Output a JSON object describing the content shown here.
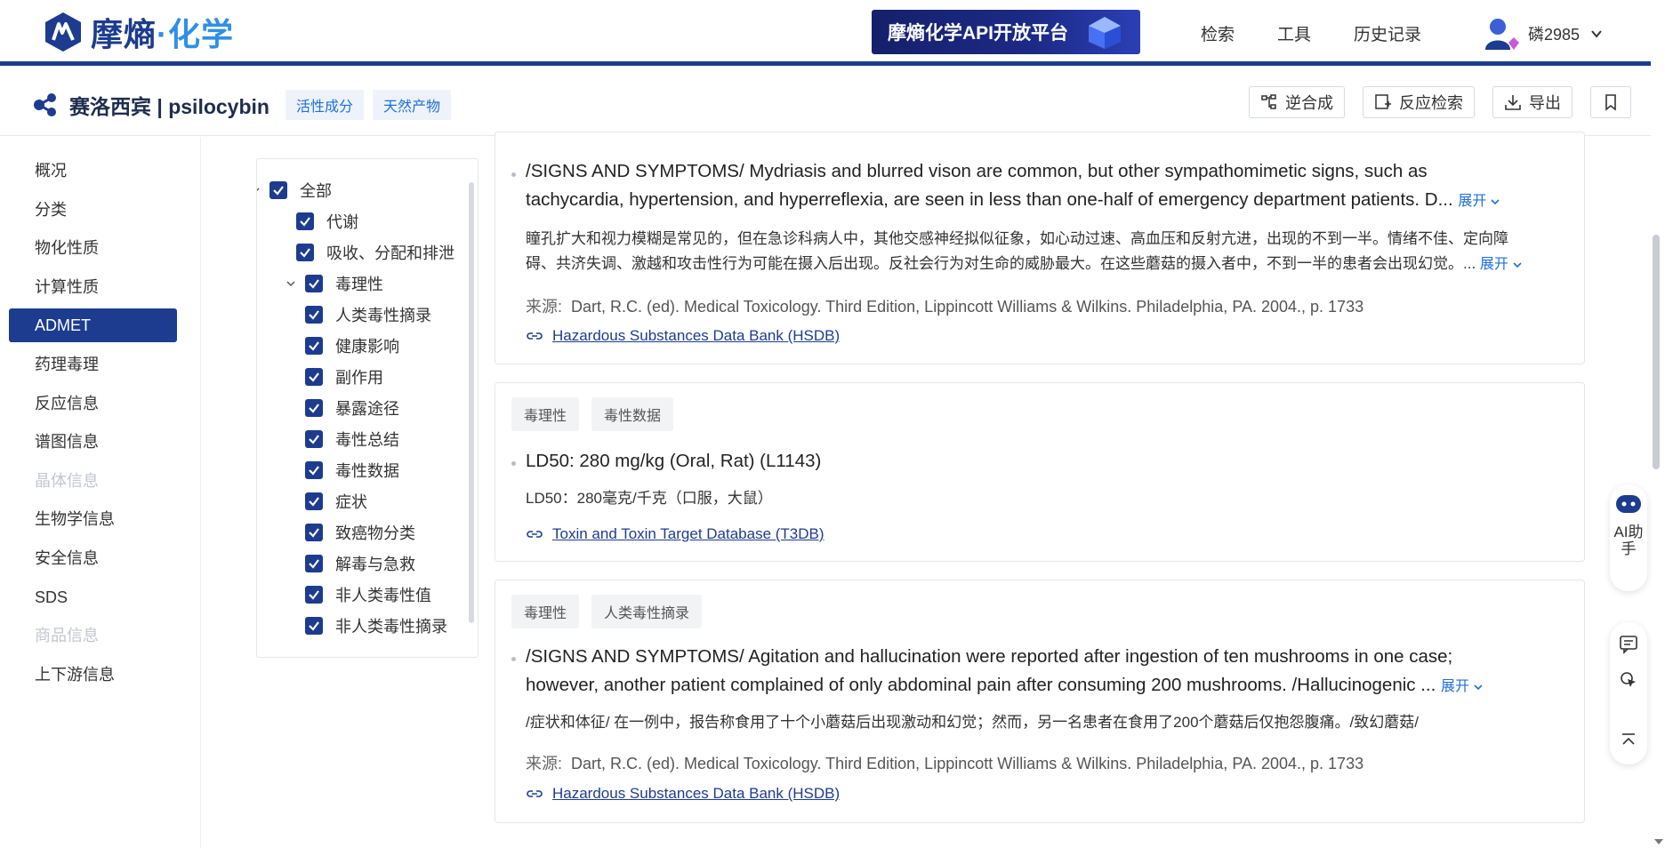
{
  "header": {
    "logo_main": "摩熵",
    "logo_dot": "·",
    "logo_accent": "化学",
    "api_banner": "摩熵化学API开放平台",
    "nav": [
      "检索",
      "工具",
      "历史记录"
    ],
    "username": "磷2985"
  },
  "compound": {
    "title": "赛洛西宾 | psilocybin",
    "tags": [
      "活性成分",
      "天然产物"
    ]
  },
  "toolbar": {
    "retro_label": "逆合成",
    "reaction_label": "反应检索",
    "export_label": "导出"
  },
  "sidebar": {
    "items": [
      {
        "label": "概况",
        "state": "normal"
      },
      {
        "label": "分类",
        "state": "normal"
      },
      {
        "label": "物化性质",
        "state": "normal"
      },
      {
        "label": "计算性质",
        "state": "normal"
      },
      {
        "label": "ADMET",
        "state": "active"
      },
      {
        "label": "药理毒理",
        "state": "normal"
      },
      {
        "label": "反应信息",
        "state": "normal"
      },
      {
        "label": "谱图信息",
        "state": "normal"
      },
      {
        "label": "晶体信息",
        "state": "disabled"
      },
      {
        "label": "生物学信息",
        "state": "normal"
      },
      {
        "label": "安全信息",
        "state": "normal"
      },
      {
        "label": "SDS",
        "state": "normal"
      },
      {
        "label": "商品信息",
        "state": "disabled"
      },
      {
        "label": "上下游信息",
        "state": "normal"
      }
    ]
  },
  "filter_tree": {
    "items": [
      {
        "label": "全部",
        "level": 0,
        "expandable": true
      },
      {
        "label": "代谢",
        "level": 1,
        "expandable": false
      },
      {
        "label": "吸收、分配和排泄",
        "level": 1,
        "expandable": false
      },
      {
        "label": "毒理性",
        "level": 1,
        "expandable": true
      },
      {
        "label": "人类毒性摘录",
        "level": 2,
        "expandable": false
      },
      {
        "label": "健康影响",
        "level": 2,
        "expandable": false
      },
      {
        "label": "副作用",
        "level": 2,
        "expandable": false
      },
      {
        "label": "暴露途径",
        "level": 2,
        "expandable": false
      },
      {
        "label": "毒性总结",
        "level": 2,
        "expandable": false
      },
      {
        "label": "毒性数据",
        "level": 2,
        "expandable": false
      },
      {
        "label": "症状",
        "level": 2,
        "expandable": false
      },
      {
        "label": "致癌物分类",
        "level": 2,
        "expandable": false
      },
      {
        "label": "解毒与急救",
        "level": 2,
        "expandable": false
      },
      {
        "label": "非人类毒性值",
        "level": 2,
        "expandable": false
      },
      {
        "label": "非人类毒性摘录",
        "level": 2,
        "expandable": false
      }
    ]
  },
  "cards": [
    {
      "en_line1": "/SIGNS AND SYMPTOMS/ Mydriasis and blurred vison are common, but other sympathomimetic signs, such as",
      "en_line2": "tachycardia, hypertension, and hyperreflexia, are seen in less than one-half of emergency department patients. D...",
      "cn_line1": "瞳孔扩大和视力模糊是常见的，但在急诊科病人中，其他交感神经拟似征象，如心动过速、高血压和反射亢进，出现的不到一半。情绪不佳、定向障",
      "cn_line2": "碍、共济失调、激越和攻击性行为可能在摄入后出现。反社会行为对生命的威胁最大。在这些蘑菇的摄入者中，不到一半的患者会出现幻觉。...",
      "source_label": "来源:",
      "source": "Dart, R.C. (ed). Medical Toxicology. Third Edition, Lippincott Williams & Wilkins. Philadelphia, PA. 2004., p. 1733",
      "link": "Hazardous Substances Data Bank (HSDB)"
    },
    {
      "chips": [
        "毒理性",
        "毒性数据"
      ],
      "en_line1": "LD50: 280 mg/kg (Oral, Rat) (L1143)",
      "cn_line1": "LD50：280毫克/千克（口服，大鼠）",
      "link": "Toxin and Toxin Target Database (T3DB)"
    },
    {
      "chips": [
        "毒理性",
        "人类毒性摘录"
      ],
      "en_line1": "/SIGNS AND SYMPTOMS/ Agitation and hallucination were reported after ingestion of ten mushrooms in one case;",
      "en_line2": "however, another patient complained of only abdominal pain after consuming 200 mushrooms. /Hallucinogenic ...",
      "cn_line1": "/症状和体征/ 在一例中，报告称食用了十个小蘑菇后出现激动和幻觉；然而，另一名患者在食用了200个蘑菇后仅抱怨腹痛。/致幻蘑菇/",
      "source_label": "来源:",
      "source": "Dart, R.C. (ed). Medical Toxicology. Third Edition, Lippincott Williams & Wilkins. Philadelphia, PA. 2004., p. 1733",
      "link": "Hazardous Substances Data Bank (HSDB)"
    }
  ],
  "expand_label": "展开",
  "ai_label": "AI助手",
  "colors": {
    "brand": "#1d3c8f",
    "accent": "#2f8fe8",
    "link": "#1e6fd9"
  }
}
